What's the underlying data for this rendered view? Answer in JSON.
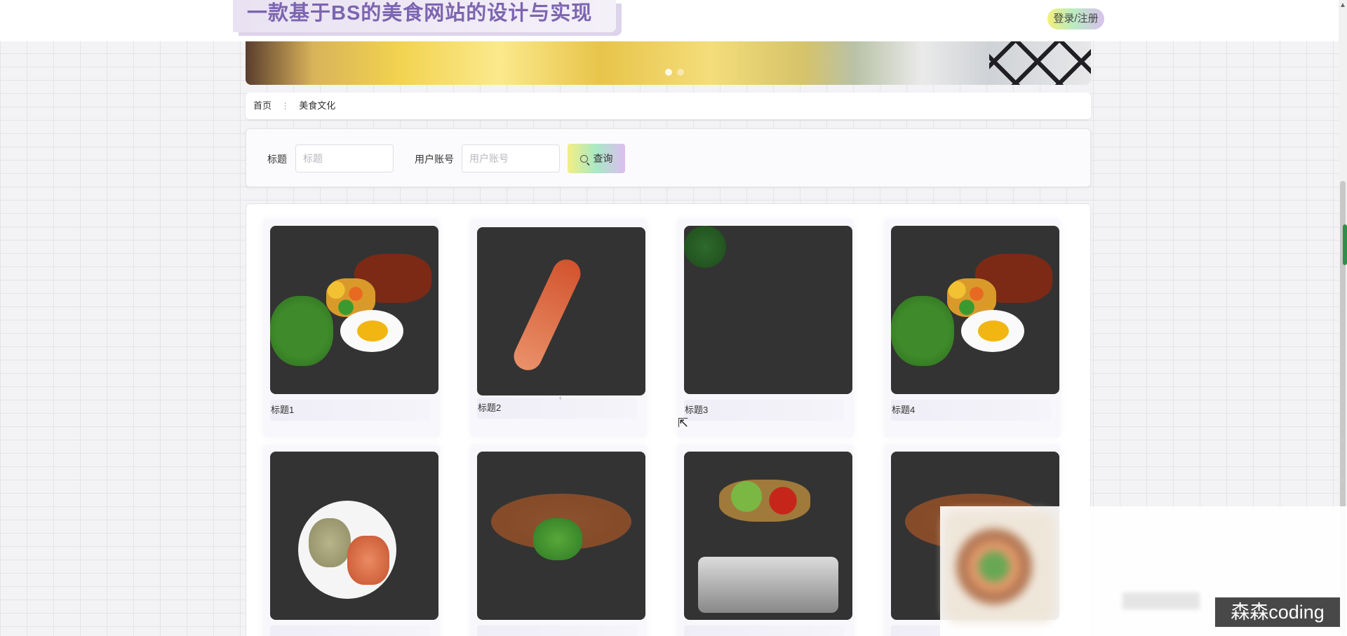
{
  "site": {
    "title": "一款基于BS的美食网站的设计与实现",
    "login_label": "登录/注册"
  },
  "breadcrumb": {
    "home": "首页",
    "separator": "⋮",
    "current": "美食文化"
  },
  "search": {
    "title_label": "标题",
    "title_placeholder": "标题",
    "title_value": "",
    "account_label": "用户账号",
    "account_placeholder": "用户账号",
    "account_value": "",
    "query_label": "查询"
  },
  "cards": [
    {
      "title": "标题1",
      "image": "rice-bowl-image"
    },
    {
      "title": "标题2",
      "image": "spicy-shrimp-image"
    },
    {
      "title": "标题3",
      "image": "hotpot-image"
    },
    {
      "title": "标题4",
      "image": "rice-bowl-image"
    },
    {
      "title": "",
      "image": "fish-plate-image"
    },
    {
      "title": "",
      "image": "noodle-soup-image"
    },
    {
      "title": "",
      "image": "dry-pot-image"
    },
    {
      "title": "",
      "image": "noodle-soup-image"
    }
  ],
  "watermark": "森森coding",
  "colors": {
    "title_text": "#7c65b0",
    "button_gradient": [
      "#f3ee82",
      "#a9e9c6",
      "#dcbdf0"
    ]
  }
}
